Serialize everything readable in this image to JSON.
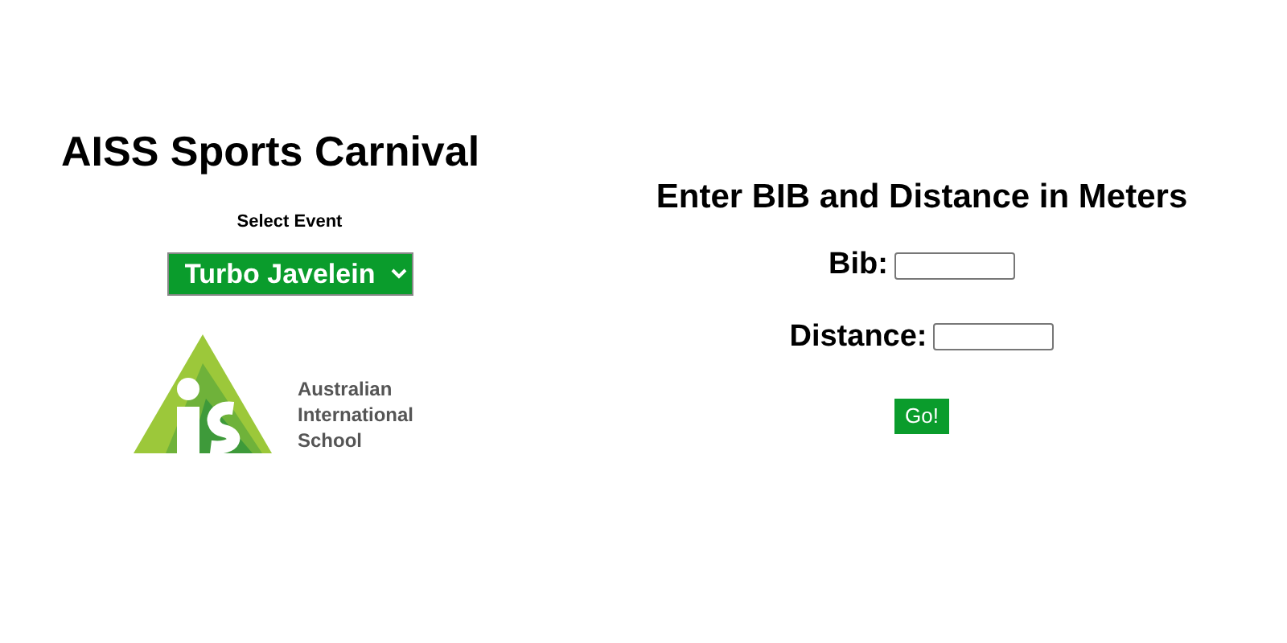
{
  "title": "AISS Sports Carnival",
  "event_select": {
    "label": "Select Event",
    "value": "Turbo Javelein"
  },
  "logo": {
    "lines": [
      "Australian",
      "International",
      "School"
    ]
  },
  "form": {
    "heading": "Enter BIB and Distance in Meters",
    "fields": [
      {
        "label": "Bib:"
      },
      {
        "label": "Distance:"
      }
    ],
    "submit": "Go!"
  }
}
